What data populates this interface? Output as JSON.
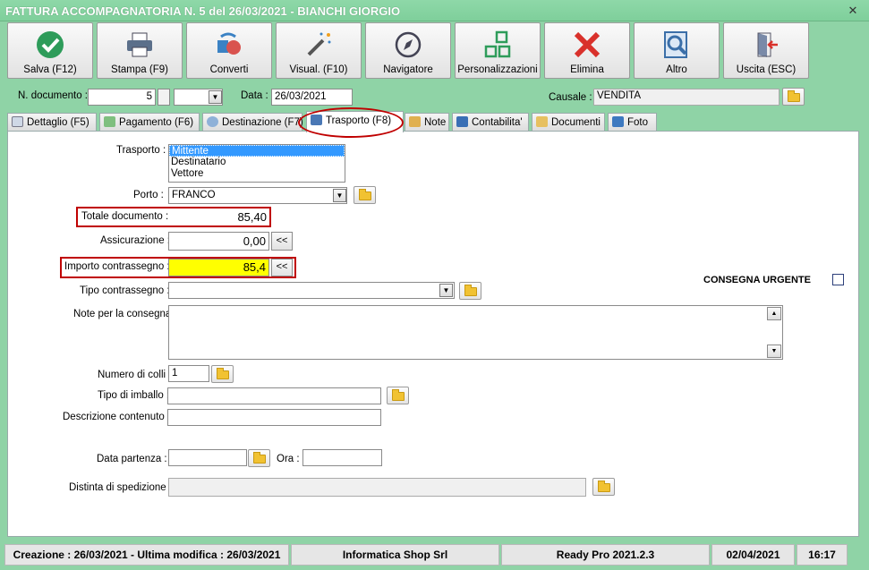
{
  "window": {
    "title": "FATTURA ACCOMPAGNATORIA N. 5 del 26/03/2021 - BIANCHI GIORGIO",
    "close": "✕"
  },
  "toolbar": {
    "buttons": [
      {
        "label": "Salva (F12)",
        "icon": "check-icon"
      },
      {
        "label": "Stampa (F9)",
        "icon": "printer-icon"
      },
      {
        "label": "Converti",
        "icon": "convert-icon"
      },
      {
        "label": "Visual. (F10)",
        "icon": "magic-wand-icon"
      },
      {
        "label": "Navigatore",
        "icon": "compass-icon"
      },
      {
        "label": "Personalizzazioni",
        "icon": "grid-icon"
      },
      {
        "label": "Elimina",
        "icon": "delete-x-icon"
      },
      {
        "label": "Altro",
        "icon": "magnifier-icon"
      },
      {
        "label": "Uscita (ESC)",
        "icon": "exit-door-icon"
      }
    ]
  },
  "header": {
    "doc_number_label": "N. documento :",
    "doc_number_value": "5",
    "date_label": "Data :",
    "date_value": "26/03/2021",
    "causale_label": "Causale :",
    "causale_value": "VENDITA"
  },
  "tabs": [
    {
      "label": "Dettaglio (F5)"
    },
    {
      "label": "Pagamento (F6)"
    },
    {
      "label": "Destinazione (F7)"
    },
    {
      "label": "Trasporto (F8)"
    },
    {
      "label": "Note"
    },
    {
      "label": "Contabilita'"
    },
    {
      "label": "Documenti"
    },
    {
      "label": "Foto"
    }
  ],
  "form": {
    "trasporto_label": "Trasporto :",
    "trasporto_options": [
      "Mittente",
      "Destinatario",
      "Vettore"
    ],
    "trasporto_selected": "Mittente",
    "porto_label": "Porto :",
    "porto_value": "FRANCO",
    "totale_label": "Totale documento :",
    "totale_value": "85,40",
    "assicurazione_label": "Assicurazione :",
    "assicurazione_value": "0,00",
    "contrassegno_label": "Importo contrassegno :",
    "contrassegno_value": "85,4",
    "copy_button": "<<",
    "tipo_contrassegno_label": "Tipo contrassegno :",
    "tipo_contrassegno_value": "",
    "consegna_urgente_label": "CONSEGNA URGENTE",
    "consegna_urgente_checked": false,
    "note_label": "Note per la consegna",
    "note_value": "",
    "colli_label": "Numero di colli :",
    "colli_value": "1",
    "imballo_label": "Tipo di imballo :",
    "imballo_value": "",
    "contenuto_label": "Descrizione contenuto :",
    "contenuto_value": "",
    "partenza_label": "Data partenza :",
    "partenza_value": "",
    "ora_label": "Ora :",
    "ora_value": "",
    "distinta_label": "Distinta di spedizione :",
    "distinta_value": ""
  },
  "status": {
    "dates": "Creazione : 26/03/2021 - Ultima modifica : 26/03/2021",
    "company": "Informatica Shop Srl",
    "version": "Ready Pro 2021.2.3",
    "date": "02/04/2021",
    "time": "16:17"
  },
  "colors": {
    "frame": "#8fd3a6",
    "highlight": "#ffff00",
    "annotation": "#c00000",
    "selection": "#3399ff"
  }
}
